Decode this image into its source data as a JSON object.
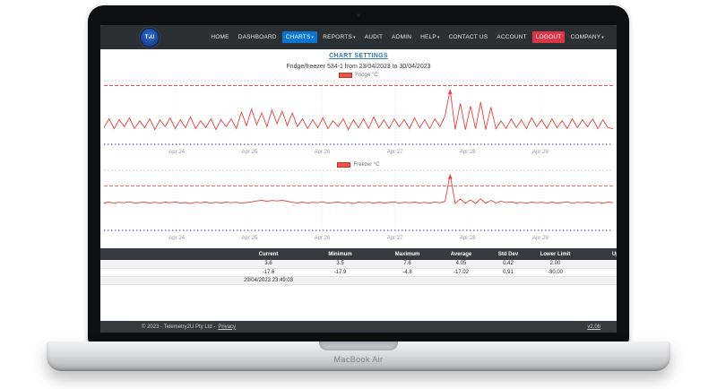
{
  "frame": {
    "device_label": "MacBook Air"
  },
  "navbar": {
    "logo_text": "T₂U",
    "items": [
      {
        "label": "HOME"
      },
      {
        "label": "DASHBOARD"
      },
      {
        "label": "CHARTS",
        "caret": true,
        "active": true
      },
      {
        "label": "REPORTS",
        "caret": true
      },
      {
        "label": "AUDIT"
      },
      {
        "label": "ADMIN"
      },
      {
        "label": "HELP",
        "caret": true
      },
      {
        "label": "CONTACT US"
      },
      {
        "label": "ACCOUNT"
      },
      {
        "label": "LOGOUT",
        "danger": true
      },
      {
        "label": "COMPANY",
        "caret": true
      }
    ]
  },
  "page": {
    "settings_link": "CHART SETTINGS",
    "title": "Fridge/freezer 534-1 from 23/04/2023 to 30/04/2023"
  },
  "chart_data": [
    {
      "type": "line",
      "title": "Fridge °C",
      "unit": "°C",
      "line_color": "#e8423d",
      "upper_limit": 8.0,
      "lower_limit": 2.0,
      "upper_limit_color": "#ff2d2d",
      "lower_limit_color": "#3333bb",
      "ylim": [
        2,
        8.5
      ],
      "x_range_days": [
        0,
        7
      ],
      "x_axis": {
        "start": "23/04/2023",
        "end": "30/04/2023"
      },
      "x_tick_days": [
        1,
        2,
        3,
        4,
        5,
        6
      ],
      "x_tick_labels": [
        "Apr 24",
        "Apr 25",
        "Apr 26",
        "Apr 27",
        "Apr 28",
        "Apr 29"
      ],
      "values": [
        3.7,
        4.6,
        3.6,
        4.5,
        3.8,
        4.7,
        3.6,
        4.4,
        3.7,
        4.6,
        3.5,
        4.5,
        3.8,
        4.7,
        3.6,
        4.5,
        3.7,
        4.8,
        3.6,
        4.4,
        3.7,
        4.6,
        3.5,
        4.5,
        3.8,
        4.6,
        3.6,
        5.3,
        3.9,
        5.6,
        4.0,
        5.2,
        3.8,
        5.5,
        4.1,
        5.4,
        3.9,
        5.2,
        3.8,
        4.6,
        3.6,
        4.5,
        3.7,
        4.7,
        3.6,
        4.4,
        3.8,
        4.6,
        3.5,
        4.5,
        3.7,
        4.6,
        3.6,
        4.8,
        3.7,
        4.5,
        3.6,
        4.6,
        3.8,
        4.5,
        3.6,
        4.7,
        3.7,
        4.5,
        3.6,
        4.6,
        3.8,
        4.9,
        7.6,
        3.5,
        6.2,
        3.5,
        5.9,
        3.6,
        6.3,
        3.5,
        5.8,
        3.6,
        4.4,
        3.6,
        4.6,
        3.7,
        4.5,
        3.6,
        4.7,
        3.8,
        4.5,
        3.6,
        4.6,
        3.7,
        4.4,
        3.6,
        4.6,
        3.7,
        4.5,
        3.8,
        4.6,
        3.6,
        4.5,
        3.7,
        3.6
      ]
    },
    {
      "type": "line",
      "title": "Freezer °C",
      "unit": "°C",
      "line_color": "#e8423d",
      "upper_limit": -10.0,
      "lower_limit": -30.0,
      "upper_limit_color": "#ff2d2d",
      "lower_limit_color": "#3333bb",
      "ylim": [
        -30,
        -3
      ],
      "x_range_days": [
        0,
        7
      ],
      "x_axis": {
        "start": "23/04/2023",
        "end": "30/04/2023"
      },
      "x_tick_days": [
        1,
        2,
        3,
        4,
        5,
        6
      ],
      "x_tick_labels": [
        "Apr 24",
        "Apr 25",
        "Apr 26",
        "Apr 27",
        "Apr 28",
        "Apr 29"
      ],
      "values": [
        -17.7,
        -17.3,
        -17.8,
        -17.4,
        -17.6,
        -17.2,
        -17.8,
        -17.5,
        -17.3,
        -17.7,
        -17.4,
        -17.8,
        -17.3,
        -17.6,
        -17.2,
        -17.7,
        -17.5,
        -17.9,
        -17.4,
        -17.6,
        -17.3,
        -17.8,
        -17.4,
        -17.7,
        -17.3,
        -17.6,
        -17.4,
        -17.8,
        -17.5,
        -17.2,
        -16.8,
        -16.5,
        -16.9,
        -16.6,
        -16.8,
        -16.5,
        -16.9,
        -17.4,
        -17.7,
        -17.3,
        -17.8,
        -17.4,
        -17.6,
        -17.2,
        -17.8,
        -17.5,
        -17.3,
        -17.7,
        -17.4,
        -17.9,
        -17.3,
        -17.6,
        -17.4,
        -17.8,
        -17.3,
        -17.7,
        -17.5,
        -17.2,
        -17.8,
        -17.4,
        -17.6,
        -17.3,
        -17.7,
        -17.4,
        -17.8,
        -17.3,
        -17.6,
        -17.0,
        -4.8,
        -17.9,
        -15.9,
        -17.8,
        -16.3,
        -17.9,
        -15.8,
        -17.8,
        -16.5,
        -17.7,
        -16.9,
        -17.5,
        -17.2,
        -17.7,
        -17.4,
        -17.8,
        -17.3,
        -17.6,
        -17.4,
        -17.8,
        -17.3,
        -17.7,
        -17.5,
        -17.2,
        -17.8,
        -17.4,
        -17.6,
        -17.3,
        -17.7,
        -17.4,
        -17.8,
        -17.3,
        -17.6
      ]
    }
  ],
  "table": {
    "headers": [
      "",
      "Current",
      "Minimum",
      "Maximum",
      "Average",
      "Std Dev",
      "Lower Limit",
      "Upper Limit"
    ],
    "rows": [
      [
        "",
        "3.6",
        "3.5",
        "7.6",
        "4.05",
        "0.42",
        "2.00",
        ""
      ],
      [
        "",
        "-17.6",
        "-17.9",
        "-4.8",
        "-17.02",
        "0.91",
        "-30.00",
        ""
      ],
      [
        "",
        "29/04/2023 23:49:03",
        "",
        "",
        "",
        "",
        "",
        ""
      ]
    ]
  },
  "footer": {
    "copyright": "© 2023 - Telemetry2U Pty Ltd -",
    "privacy_link": "Privacy",
    "version_link": "v2.0b"
  },
  "colors": {
    "navbar_bg": "#2b3035",
    "active_nav": "#0b76d1",
    "logout_red": "#dc3545",
    "link_blue": "#337ab7",
    "series_red": "#e8423d",
    "table_header_bg": "#343a40",
    "footer_bg": "#343a40"
  }
}
